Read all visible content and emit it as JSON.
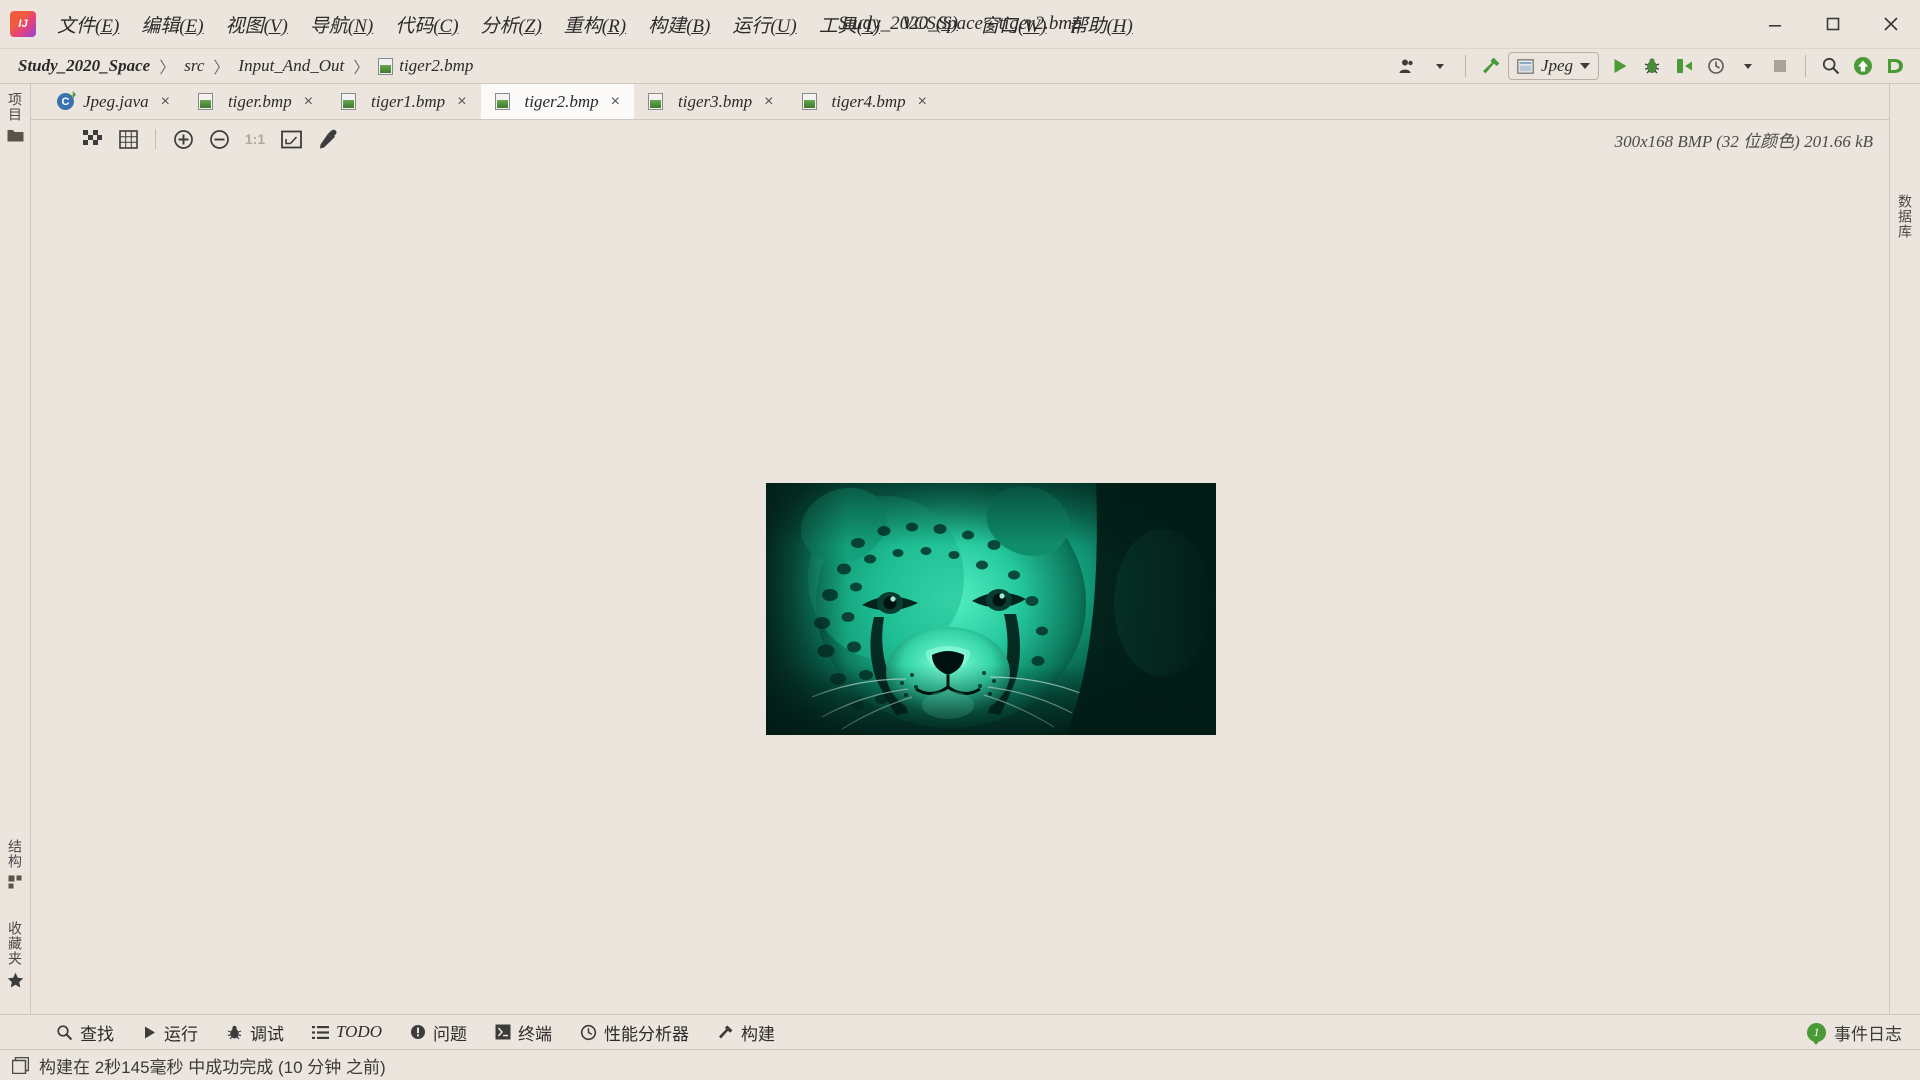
{
  "window": {
    "title": "Study_2020_Space - tiger2.bmp",
    "logo_alt": "intellij-idea-logo",
    "minimize_label": "Minimize",
    "maximize_label": "Maximize",
    "close_label": "Close"
  },
  "menu": {
    "items": [
      {
        "label": "文件",
        "mnemonic": "(E)"
      },
      {
        "label": "编辑",
        "mnemonic": "(E)"
      },
      {
        "label": "视图",
        "mnemonic": "(V)"
      },
      {
        "label": "导航",
        "mnemonic": "(N)"
      },
      {
        "label": "代码",
        "mnemonic": "(C)"
      },
      {
        "label": "分析",
        "mnemonic": "(Z)"
      },
      {
        "label": "重构",
        "mnemonic": "(R)"
      },
      {
        "label": "构建",
        "mnemonic": "(B)"
      },
      {
        "label": "运行",
        "mnemonic": "(U)"
      },
      {
        "label": "工具",
        "mnemonic": "(T)"
      },
      {
        "label": "VCS",
        "mnemonic": "(S)"
      },
      {
        "label": "窗口",
        "mnemonic": "(W)"
      },
      {
        "label": "帮助",
        "mnemonic": "(H)"
      }
    ]
  },
  "breadcrumb": {
    "items": [
      "Study_2020_Space",
      "src",
      "Input_And_Out",
      "tiger2.bmp"
    ],
    "separator": "〉"
  },
  "toolbar": {
    "person_icon": "user-dropdown-icon",
    "build_icon": "hammer-icon",
    "run_config": {
      "label": "Jpeg",
      "icon": "run-config-icon"
    },
    "run_icon": "run-play-icon",
    "debug_icon": "debug-bug-icon",
    "coverage_icon": "run-with-coverage-icon",
    "profile_icon": "profiler-icon",
    "stop_icon": "stop-icon",
    "search_icon": "search-everywhere-icon",
    "update_icon": "update-project-icon",
    "ide_icon": "ide-and-project-settings-icon"
  },
  "tabs": [
    {
      "label": "Jpeg.java",
      "icon": "java-class-icon",
      "active": false,
      "close": "×"
    },
    {
      "label": "tiger.bmp",
      "icon": "bmp-image-icon",
      "active": false,
      "close": "×"
    },
    {
      "label": "tiger1.bmp",
      "icon": "bmp-image-icon",
      "active": false,
      "close": "×"
    },
    {
      "label": "tiger2.bmp",
      "icon": "bmp-image-icon",
      "active": true,
      "close": "×"
    },
    {
      "label": "tiger3.bmp",
      "icon": "bmp-image-icon",
      "active": false,
      "close": "×"
    },
    {
      "label": "tiger4.bmp",
      "icon": "bmp-image-icon",
      "active": false,
      "close": "×"
    }
  ],
  "image_editor": {
    "toolbar": [
      {
        "name": "toggle-transparency-chessboard-icon",
        "label": "Transparency chessboard",
        "disabled": false
      },
      {
        "name": "toggle-grid-icon",
        "label": "Grid",
        "disabled": false
      },
      {
        "name": "zoom-in-icon",
        "label": "Zoom In",
        "disabled": false
      },
      {
        "name": "zoom-out-icon",
        "label": "Zoom Out",
        "disabled": false
      },
      {
        "name": "actual-size-icon",
        "label": "1:1",
        "disabled": true
      },
      {
        "name": "fit-to-window-icon",
        "label": "Fit Zoom to Window",
        "disabled": false
      },
      {
        "name": "color-picker-icon",
        "label": "Color Picker",
        "disabled": false
      }
    ],
    "info": "300x168 BMP (32 位颜色) 201.66 kB",
    "dimensions": "300x168",
    "format": "BMP",
    "color_depth": "32 位颜色",
    "file_size": "201.66 kB",
    "image_alt": "cheetah-photo-teal-tinted"
  },
  "left_rail": {
    "top": [
      {
        "label": "项目",
        "name": "tool-window-project"
      }
    ],
    "top_icons": [
      {
        "name": "project-folder-icon"
      }
    ],
    "bottom": [
      {
        "label": "结构",
        "name": "tool-window-structure",
        "icon": "structure-icon"
      },
      {
        "label": "收藏夹",
        "name": "tool-window-favorites",
        "icon": "star-icon"
      }
    ]
  },
  "right_rail": {
    "items": [
      {
        "label": "数据库",
        "name": "tool-window-database"
      }
    ]
  },
  "tool_windows": [
    {
      "label": "查找",
      "icon": "search-icon"
    },
    {
      "label": "运行",
      "icon": "play-icon"
    },
    {
      "label": "调试",
      "icon": "bug-icon"
    },
    {
      "label": "TODO",
      "icon": "todo-list-icon",
      "italic": true
    },
    {
      "label": "问题",
      "icon": "problems-icon"
    },
    {
      "label": "终端",
      "icon": "terminal-icon"
    },
    {
      "label": "性能分析器",
      "icon": "profiler-icon"
    },
    {
      "label": "构建",
      "icon": "build-hammer-icon"
    }
  ],
  "event_log": {
    "label": "事件日志",
    "count": "1",
    "badge_color": "#4a9a38"
  },
  "status": {
    "icon": "memory-indicator-icon",
    "text": "构建在 2秒145毫秒 中成功完成 (10 分钟 之前)"
  },
  "colors": {
    "chrome_bg": "#ece5dd",
    "tab_active_bg": "#fbfaf8",
    "accent_green": "#4a9a38",
    "text": "#2b2b2b",
    "border": "#cfc8bf"
  }
}
